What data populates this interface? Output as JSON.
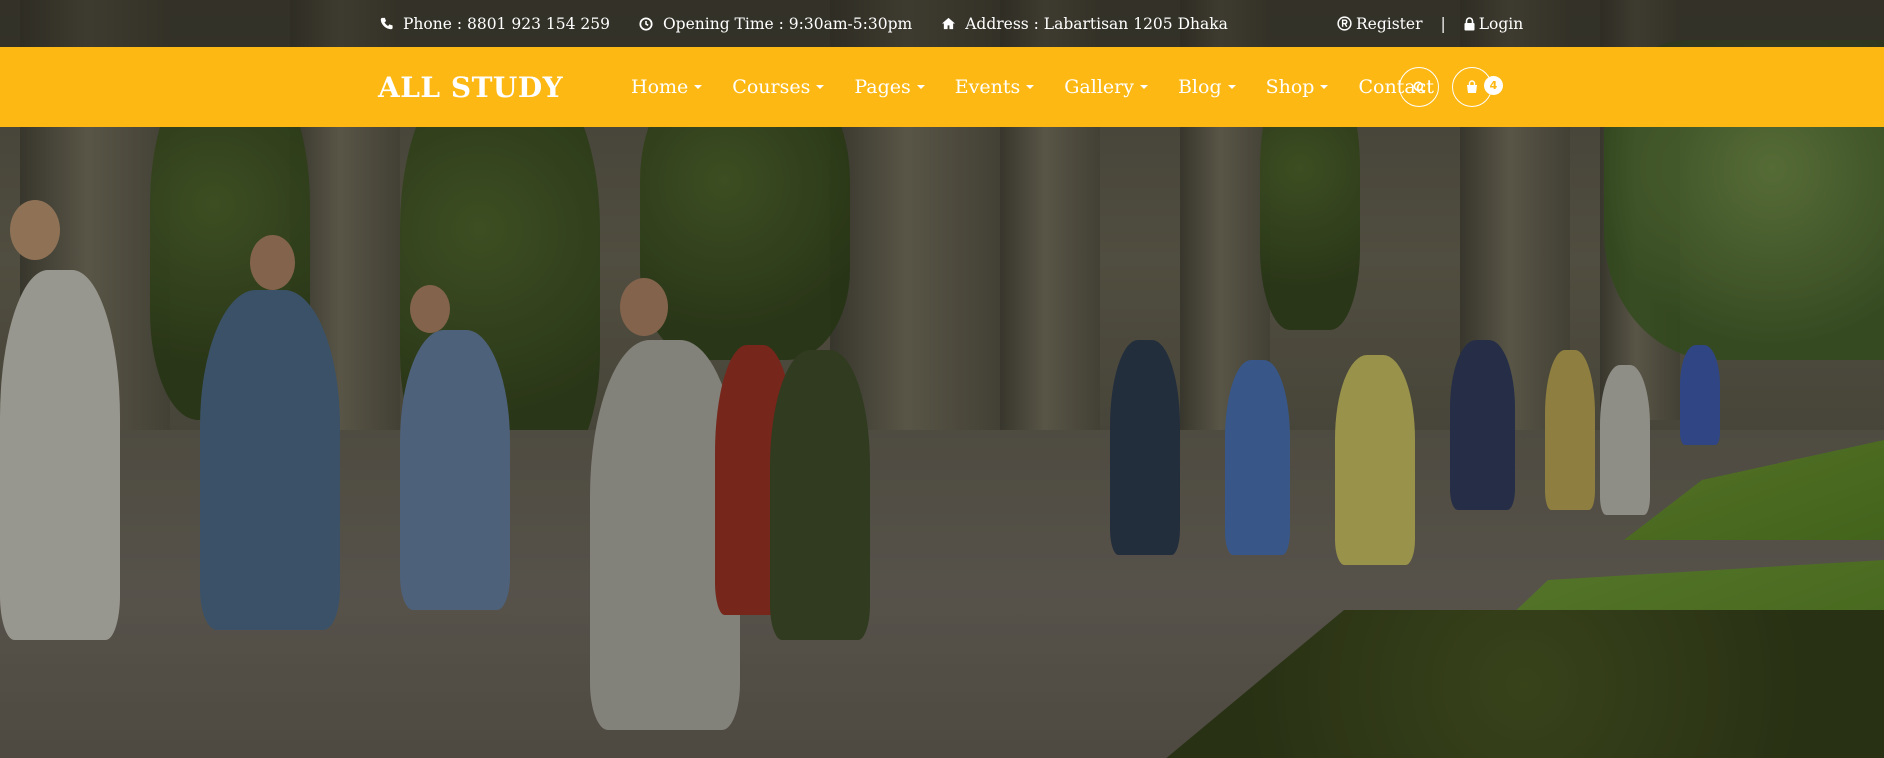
{
  "topbar": {
    "phone": {
      "icon": "phone-icon",
      "text": "Phone : 8801 923 154 259"
    },
    "opening": {
      "icon": "clock-icon",
      "text": "Opening Time : 9:30am-5:30pm"
    },
    "address": {
      "icon": "home-icon",
      "text": "Address : Labartisan 1205 Dhaka"
    },
    "register": {
      "icon": "registered-icon",
      "text": "Register"
    },
    "separator": "|",
    "login": {
      "icon": "lock-icon",
      "text": "Login"
    }
  },
  "navbar": {
    "background": "#fdb813",
    "logo": "ALL STUDY",
    "menu": [
      {
        "label": "Home",
        "dropdown": true
      },
      {
        "label": "Courses",
        "dropdown": true
      },
      {
        "label": "Pages",
        "dropdown": true
      },
      {
        "label": "Events",
        "dropdown": true
      },
      {
        "label": "Gallery",
        "dropdown": true
      },
      {
        "label": "Blog",
        "dropdown": true
      },
      {
        "label": "Shop",
        "dropdown": true
      },
      {
        "label": "Contact",
        "dropdown": false
      }
    ],
    "search_icon": "search-icon",
    "cart_icon": "shopping-bag-icon",
    "cart_count": "4"
  },
  "hero": {
    "image": "campus-students-walking-photo"
  }
}
